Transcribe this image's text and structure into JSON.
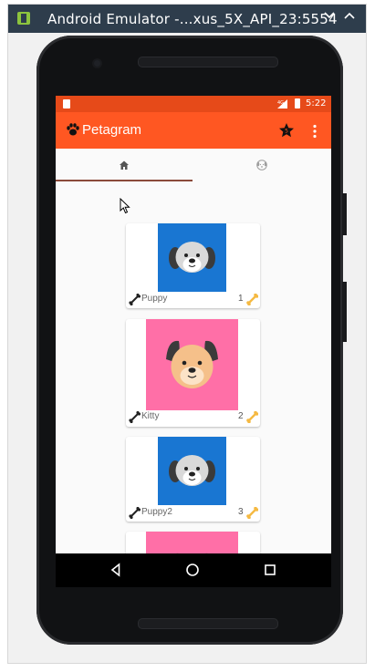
{
  "window": {
    "title": "Android Emulator -...xus_5X_API_23:5554",
    "collapse_icon": "chevron-down-icon",
    "close_icon": "chevron-up-icon"
  },
  "statusbar": {
    "time": "5:22",
    "network": "4G"
  },
  "appbar": {
    "title": "Petagram",
    "star_badge": "5",
    "color": "#ff5722"
  },
  "tabs": [
    {
      "name": "home",
      "icon": "home-icon",
      "selected": true
    },
    {
      "name": "profile",
      "icon": "dog-face-icon",
      "selected": false
    }
  ],
  "pets": [
    {
      "name": "Puppy",
      "likes": "1",
      "bg": "#1976d2"
    },
    {
      "name": "Kitty",
      "likes": "2",
      "bg": "#ff6fa7"
    },
    {
      "name": "Puppy2",
      "likes": "3",
      "bg": "#1976d2"
    },
    {
      "name": "",
      "likes": "",
      "bg": "#ff6fa7"
    }
  ],
  "colors": {
    "status_bar": "#e64a19",
    "tab_indicator": "#8b4a3a",
    "like_bone": "#f5b942"
  }
}
